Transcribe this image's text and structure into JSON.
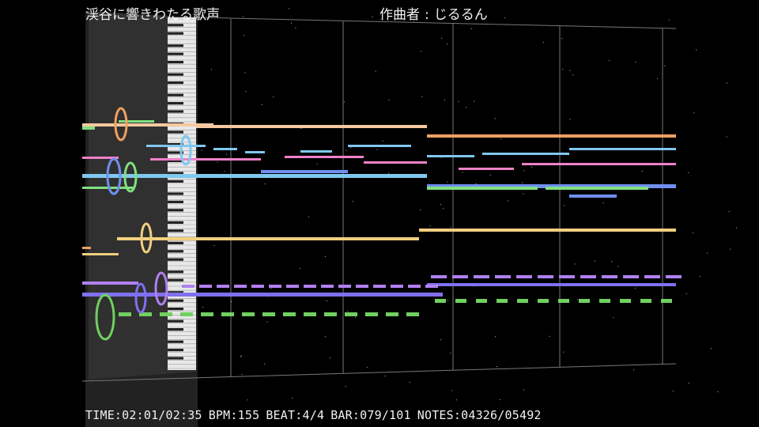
{
  "header": {
    "song_title": "渓谷に響きわたる歌声",
    "composer_label": "作曲者",
    "composer_sep": ":",
    "composer_name": "じるるん"
  },
  "status": {
    "time": "TIME:02:01/02:35",
    "bpm": "BPM:155",
    "beat": "BEAT:4/4",
    "bar": "BAR:079/101",
    "notes": "NOTES:04326/05492"
  },
  "colors": {
    "background": "#000000",
    "piano_panel": "#2a2a2a",
    "grid": "#7a7a7a",
    "track_peach": "#f5c9a0",
    "track_orange": "#f0a060",
    "track_lightblue": "#7fc8f0",
    "track_pink": "#f080c8",
    "track_blue": "#6f8ff0",
    "track_green": "#80e080",
    "track_yellow": "#f0d080",
    "track_lavender": "#b080f0",
    "track_violet": "#8070f0",
    "track_lime": "#70d060"
  }
}
